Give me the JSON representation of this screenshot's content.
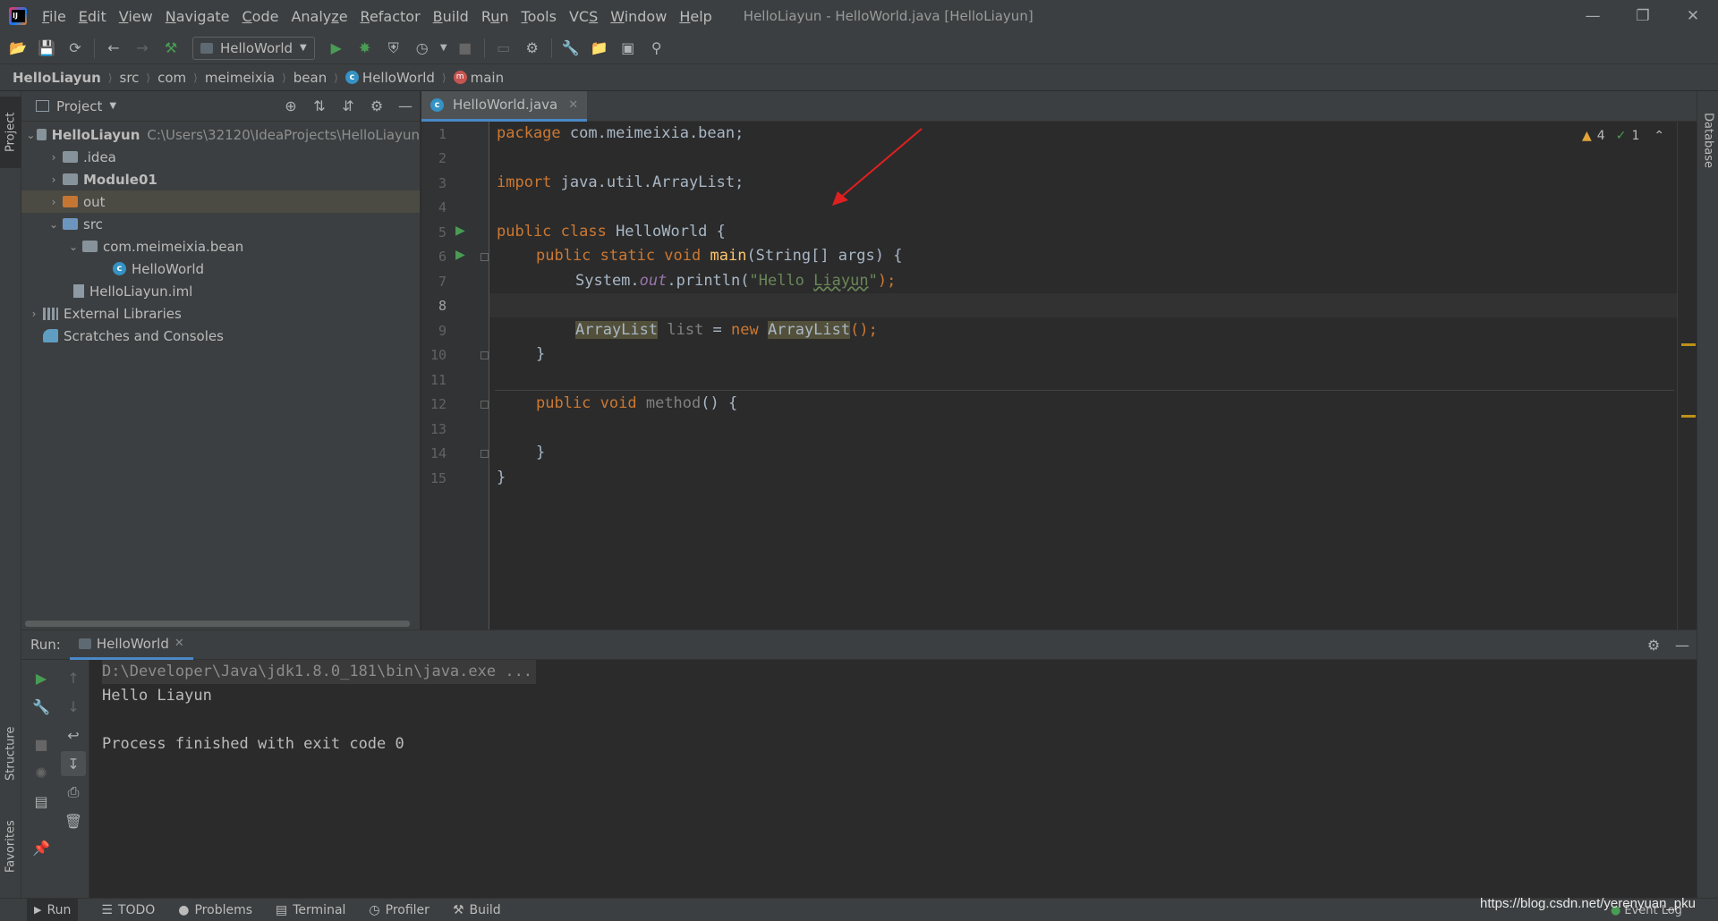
{
  "window": {
    "title": "HelloLiayun - HelloWorld.java [HelloLiayun]",
    "menu": [
      "File",
      "Edit",
      "View",
      "Navigate",
      "Code",
      "Analyze",
      "Refactor",
      "Build",
      "Run",
      "Tools",
      "VCS",
      "Window",
      "Help"
    ],
    "menu_underline": [
      "F",
      "E",
      "V",
      "N",
      "C",
      "z",
      "R",
      "B",
      "u",
      "T",
      "S",
      "W",
      "H"
    ]
  },
  "toolbar": {
    "run_config": "HelloWorld"
  },
  "breadcrumb": [
    "HelloLiayun",
    "src",
    "com",
    "meimeixia",
    "bean",
    "HelloWorld",
    "main"
  ],
  "project_panel": {
    "title": "Project",
    "tree": [
      {
        "label": "HelloLiayun",
        "path": "C:\\Users\\32120\\IdeaProjects\\HelloLiayun",
        "bold": true
      },
      {
        "label": ".idea"
      },
      {
        "label": "Module01",
        "bold": true
      },
      {
        "label": "out"
      },
      {
        "label": "src"
      },
      {
        "label": "com.meimeixia.bean"
      },
      {
        "label": "HelloWorld"
      },
      {
        "label": "HelloLiayun.iml"
      },
      {
        "label": "External Libraries"
      },
      {
        "label": "Scratches and Consoles"
      }
    ]
  },
  "side_tabs": {
    "left_top": "Project",
    "left_structure": "Structure",
    "left_favorites": "Favorites",
    "right": "Database"
  },
  "editor": {
    "tab": "HelloWorld.java",
    "line_numbers": [
      "1",
      "2",
      "3",
      "4",
      "5",
      "6",
      "7",
      "8",
      "9",
      "10",
      "11",
      "12",
      "13",
      "14",
      "15"
    ],
    "warnings": "4",
    "weak_warnings": "1",
    "code": {
      "l1_kw": "package",
      "l1_rest": " com.meimeixia.bean;",
      "l3_kw": "import",
      "l3_rest": " java.util.ArrayList;",
      "l5_kw": "public class",
      "l5_rest": " HelloWorld {",
      "l6_kw": "public static void",
      "l6_fn": "main",
      "l6_rest": "(String[] args) {",
      "l7_a": "System.",
      "l7_out": "out",
      "l7_b": ".println(",
      "l7_str1": "\"Hello ",
      "l7_str2": "Liayun",
      "l7_str3": "\"",
      "l7_c": ");",
      "l9_type": "ArrayList",
      "l9_var": " list",
      "l9_eq": " = ",
      "l9_new": "new",
      "l9_type2": "ArrayList",
      "l9_end": "();",
      "l10": "}",
      "l12_kw": "public void",
      "l12_fn": "method",
      "l12_rest": "() {",
      "l14": "}",
      "l15": "}"
    }
  },
  "run_panel": {
    "label": "Run:",
    "tab": "HelloWorld",
    "console": [
      "D:\\Developer\\Java\\jdk1.8.0_181\\bin\\java.exe ...",
      "Hello Liayun",
      "",
      "Process finished with exit code 0"
    ]
  },
  "statusbar": {
    "items": [
      "Run",
      "TODO",
      "Problems",
      "Terminal",
      "Profiler",
      "Build"
    ],
    "event_log": "Event Log",
    "watermark": "https://blog.csdn.net/yerenyuan_pku"
  },
  "colors": {
    "keyword": "#cc7832",
    "string": "#6a8759",
    "function": "#ffc66d",
    "annotation_arrow": "#e02020"
  }
}
